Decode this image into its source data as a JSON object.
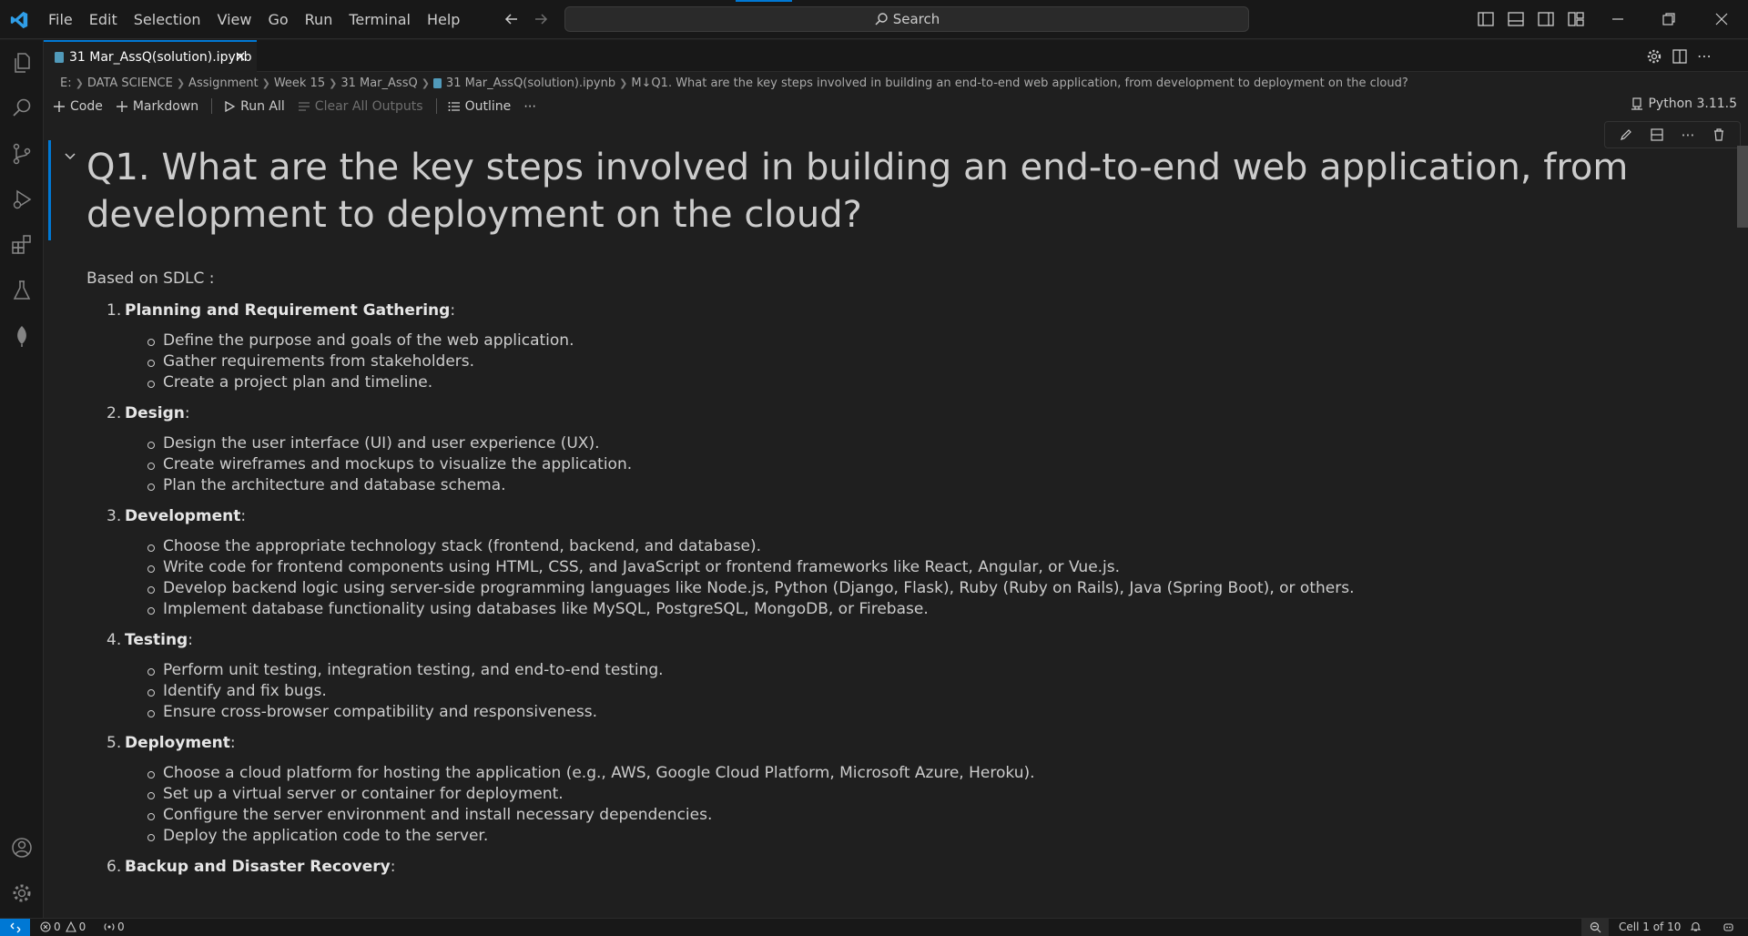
{
  "menu": {
    "items": [
      "File",
      "Edit",
      "Selection",
      "View",
      "Go",
      "Run",
      "Terminal",
      "Help"
    ]
  },
  "search": {
    "label": "Search"
  },
  "tab": {
    "title": "31 Mar_AssQ(solution).ipynb"
  },
  "breadcrumbs": [
    "E:",
    "DATA SCIENCE",
    "Assignment",
    "Week 15",
    "31 Mar_AssQ",
    "31 Mar_AssQ(solution).ipynb",
    "M↓Q1. What are the key steps involved in building an end-to-end web application, from development to deployment on the cloud?"
  ],
  "toolbar": {
    "code": "Code",
    "markdown": "Markdown",
    "run_all": "Run All",
    "clear_all": "Clear All Outputs",
    "outline": "Outline",
    "more": "⋯"
  },
  "kernel": {
    "label": "Python 3.11.5"
  },
  "cell": {
    "heading": "Q1. What are the key steps involved in building an end-to-end web application, from development to deployment on the cloud?",
    "intro": "Based on SDLC :",
    "steps": [
      {
        "num": "1.",
        "title": "Planning and Requirement Gathering",
        "bullets": [
          "Define the purpose and goals of the web application.",
          "Gather requirements from stakeholders.",
          "Create a project plan and timeline."
        ]
      },
      {
        "num": "2.",
        "title": "Design",
        "bullets": [
          "Design the user interface (UI) and user experience (UX).",
          "Create wireframes and mockups to visualize the application.",
          "Plan the architecture and database schema."
        ]
      },
      {
        "num": "3.",
        "title": "Development",
        "bullets": [
          "Choose the appropriate technology stack (frontend, backend, and database).",
          "Write code for frontend components using HTML, CSS, and JavaScript or frontend frameworks like React, Angular, or Vue.js.",
          "Develop backend logic using server-side programming languages like Node.js, Python (Django, Flask), Ruby (Ruby on Rails), Java (Spring Boot), or others.",
          "Implement database functionality using databases like MySQL, PostgreSQL, MongoDB, or Firebase."
        ]
      },
      {
        "num": "4.",
        "title": "Testing",
        "bullets": [
          "Perform unit testing, integration testing, and end-to-end testing.",
          "Identify and fix bugs.",
          "Ensure cross-browser compatibility and responsiveness."
        ]
      },
      {
        "num": "5.",
        "title": "Deployment",
        "bullets": [
          "Choose a cloud platform for hosting the application (e.g., AWS, Google Cloud Platform, Microsoft Azure, Heroku).",
          "Set up a virtual server or container for deployment.",
          "Configure the server environment and install necessary dependencies.",
          "Deploy the application code to the server."
        ]
      },
      {
        "num": "6.",
        "title": "Backup and Disaster Recovery",
        "bullets": []
      }
    ]
  },
  "status": {
    "errors": "0",
    "warnings": "0",
    "ports": "0",
    "cell_position": "Cell 1 of 10"
  },
  "colors": {
    "accent": "#0078d4",
    "background": "#1f1f1f",
    "chrome": "#181818"
  }
}
